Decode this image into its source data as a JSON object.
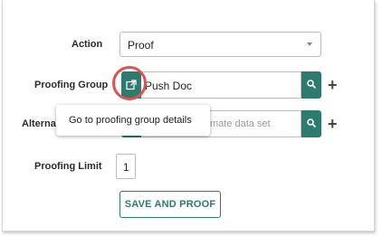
{
  "form": {
    "action_label": "Action",
    "action_value": "Proof",
    "proofing_group_label": "Proofing Group",
    "proofing_group_value": "Push Doc",
    "alternate_label": "Alternat",
    "alternate_placeholder": "mate data set",
    "proofing_limit_label": "Proofing Limit",
    "proofing_limit_value": "1",
    "submit_label": "SAVE AND PROOF",
    "add_symbol": "+"
  },
  "tooltip": {
    "text": "Go to proofing group details"
  },
  "icons": {
    "open_details": "external-link-icon",
    "search": "search-icon",
    "add": "plus-icon",
    "dropdown": "chevron-down-icon"
  },
  "colors": {
    "accent": "#2d7a6f",
    "highlight_ring": "#e05151"
  }
}
